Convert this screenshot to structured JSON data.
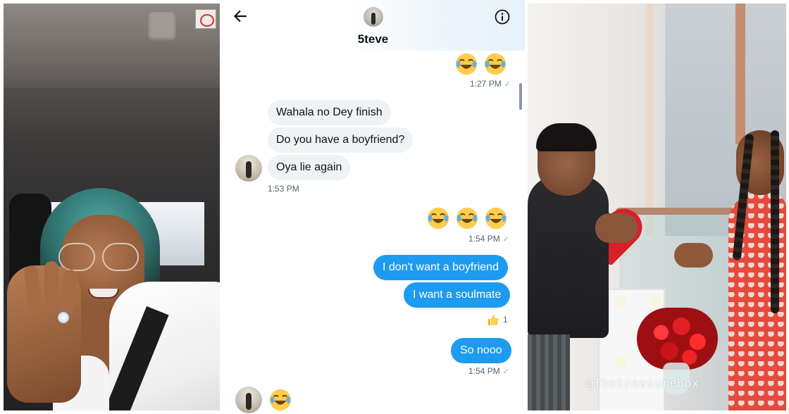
{
  "header": {
    "contact_name": "5teve",
    "back_icon": "arrow-left-icon",
    "info_icon": "info-icon"
  },
  "messages": {
    "top_emoji_ts": "1:27 PM",
    "in_1": "Wahala no Dey finish",
    "in_2": "Do you have a boyfriend?",
    "in_3": "Oya lie again",
    "in_ts": "1:53 PM",
    "mid_emoji_ts": "1:54 PM",
    "out_1": "I don't want a boyfriend",
    "out_2": "I want a soulmate",
    "reaction_count": "1",
    "out_3": "So nooo",
    "out_ts": "1:54 PM",
    "read_mark": "✓"
  },
  "photo_right": {
    "watermark": "@Thetreasurebox"
  },
  "colors": {
    "outgoing_bubble": "#1d9bf0",
    "incoming_bubble": "#eff3f4",
    "text_primary": "#0f1419",
    "text_secondary": "#536471"
  }
}
